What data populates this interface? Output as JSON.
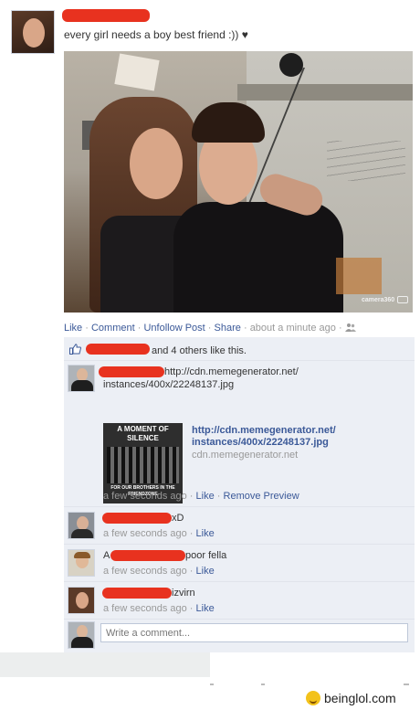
{
  "post": {
    "status_text": "every girl needs a boy best friend :)) ♥",
    "photo_tag": "camera360"
  },
  "actions": {
    "like": "Like",
    "comment": "Comment",
    "unfollow": "Unfollow Post",
    "share": "Share",
    "time": "about a minute ago",
    "sep": "·"
  },
  "likes": {
    "text": "and 4 others like this."
  },
  "link_comment": {
    "url": "http://cdn.memegenerator.net/",
    "url_2": "instances/400x/22248137.jpg",
    "preview_top": "A MOMENT OF SILENCE",
    "preview_bottom": "FOR OUR BROTHERS IN THE FRIENDZONE",
    "preview_title_1": "http://cdn.memegenerator.net/",
    "preview_title_2": "instances/400x/22248137.jpg",
    "preview_domain": "cdn.memegenerator.net",
    "meta_time": "a few seconds ago",
    "like": "Like",
    "remove": "Remove Preview"
  },
  "comments": [
    {
      "tail": "xD",
      "meta_time": "a few seconds ago",
      "like": "Like"
    },
    {
      "lead": "A",
      "tail": "poor fella",
      "meta_time": "a few seconds ago",
      "like": "Like"
    },
    {
      "tail": "izvirn",
      "meta_time": "a few seconds ago",
      "like": "Like"
    }
  ],
  "composer": {
    "placeholder": "Write a comment..."
  },
  "watermark": {
    "text": "beinglol.com"
  },
  "colors": {
    "link": "#3b5998",
    "redaction": "#e8321f",
    "comment_bg": "#eceff5"
  }
}
